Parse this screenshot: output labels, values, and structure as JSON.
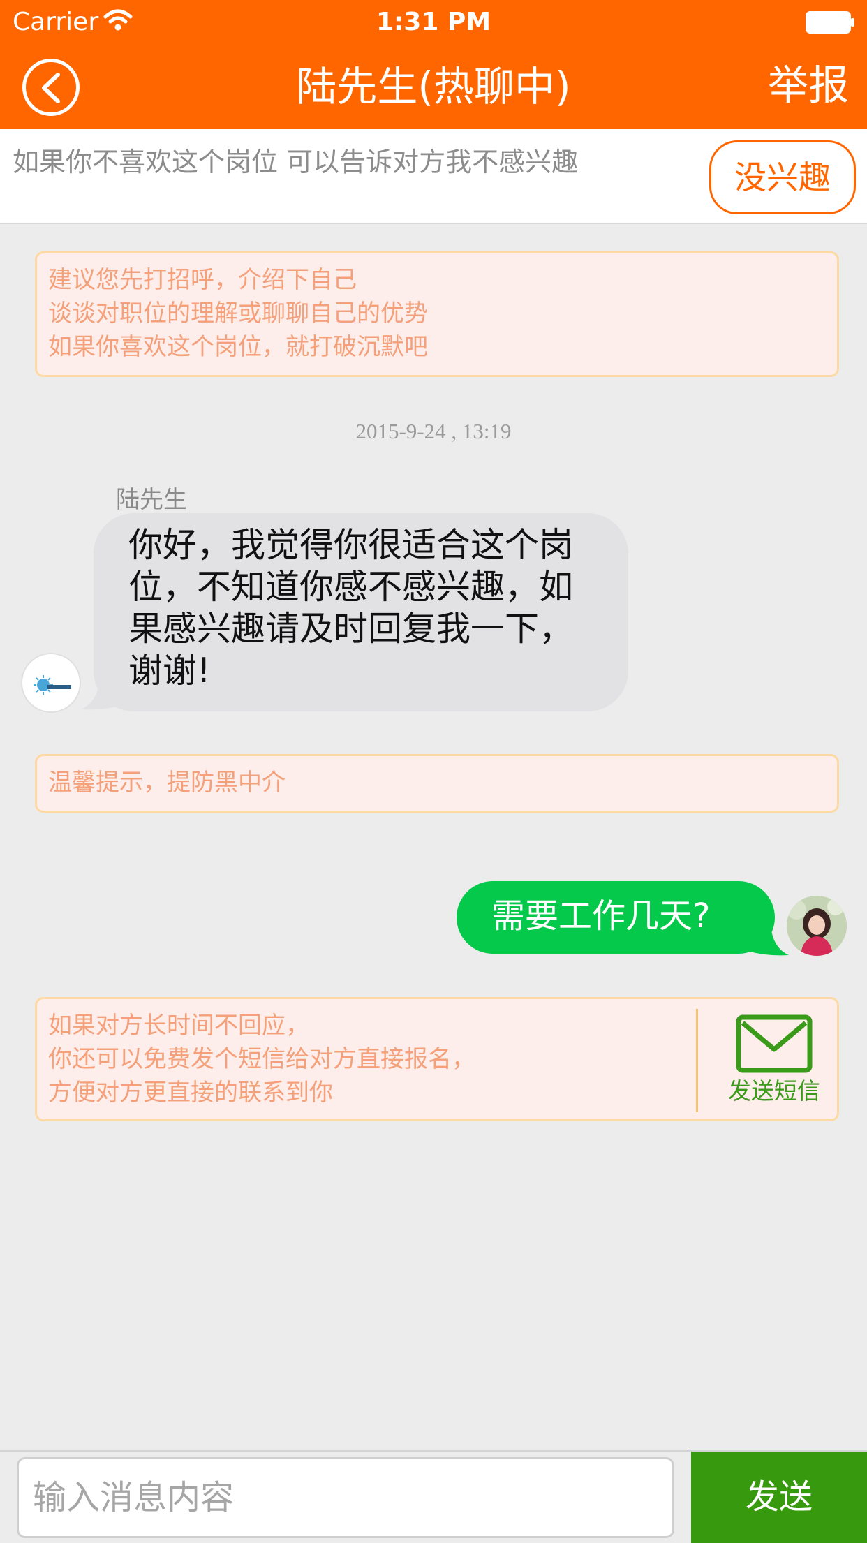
{
  "status_bar": {
    "carrier": "Carrier",
    "time": "1:31 PM"
  },
  "header": {
    "title": "陆先生(热聊中)",
    "report_label": "举报",
    "background": "#ff6600"
  },
  "interest_bar": {
    "hint": "如果你不喜欢这个岗位 可以告诉对方我不感兴趣",
    "not_interested_label": "没兴趣"
  },
  "tips": {
    "intro": [
      "建议您先打招呼，介绍下自己",
      "谈谈对职位的理解或聊聊自己的优势",
      "如果你喜欢这个岗位，就打破沉默吧"
    ],
    "warning": "温馨提示，提防黑中介",
    "sms": [
      "如果对方长时间不回应，",
      "你还可以免费发个短信给对方直接报名，",
      "方便对方更直接的联系到你"
    ],
    "sms_button_label": "发送短信"
  },
  "chat": {
    "timestamp": "2015-9-24 , 13:19",
    "incoming": {
      "sender": "陆先生",
      "text": "你好，我觉得你很适合这个岗位，不知道你感不感兴趣，如果感兴趣请及时回复我一下，谢谢!"
    },
    "outgoing": {
      "text": "需要工作几天?"
    }
  },
  "composer": {
    "placeholder": "输入消息内容",
    "send_label": "发送"
  },
  "colors": {
    "accent": "#ff6600",
    "outgoing_bubble": "#05c94a",
    "send_button": "#379a0e",
    "tip_background": "#fdeeeb",
    "tip_border": "#fdd9a3"
  }
}
